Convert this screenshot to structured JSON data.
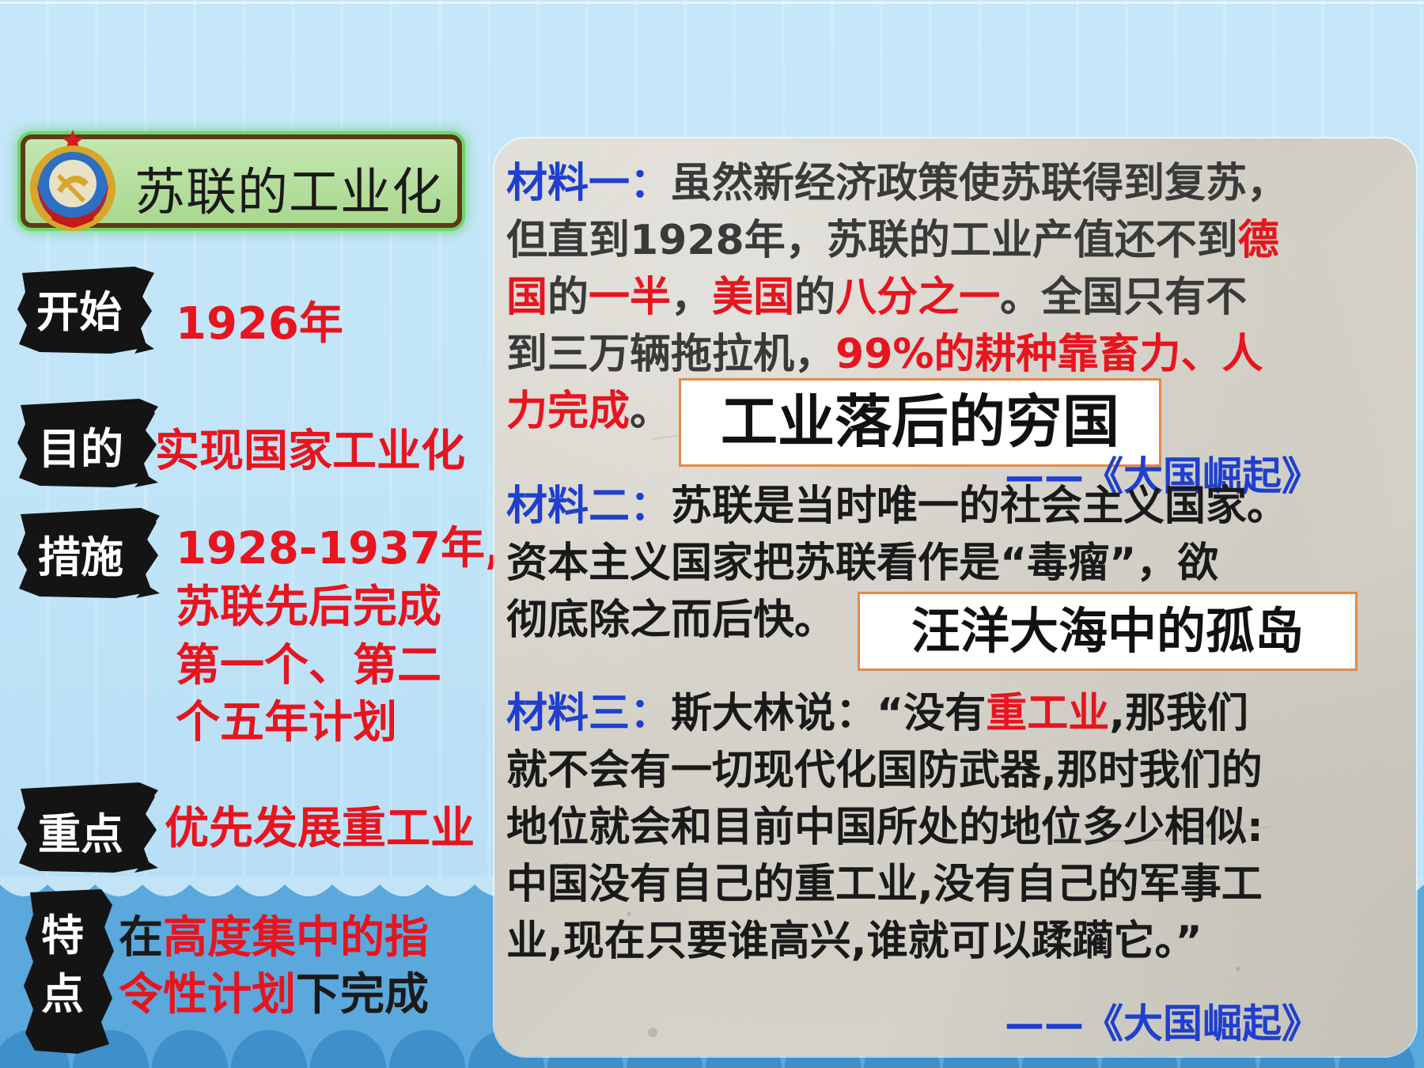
{
  "title": "苏联的工业化",
  "items": [
    {
      "label": "开始",
      "value": "1926年"
    },
    {
      "label": "目的",
      "value": "实现国家工业化"
    },
    {
      "label": "措施",
      "value_lines": [
        "1928-1937年,",
        "苏联先后完成",
        "第一个、第二",
        "个五年计划"
      ]
    },
    {
      "label": "重点",
      "value": "优先发展重工业"
    },
    {
      "label_lines": [
        "特",
        "点"
      ],
      "value_parts": [
        {
          "text": "在",
          "color": "black"
        },
        {
          "text": "高度集中的指",
          "color": "red"
        },
        {
          "text": "令性计划",
          "color": "red"
        },
        {
          "text": "下完成",
          "color": "black"
        }
      ]
    }
  ],
  "materials": {
    "m1": {
      "head": "材料一：",
      "l1": "虽然新经济政策使苏联得到复苏，",
      "l2a": "但直到1928年，苏联的工业产值还不到",
      "l2b": "德",
      "l3a": "国",
      "l3b": "的",
      "l3c": "一半",
      "l3d": "，",
      "l3e": "美国",
      "l3f": "的",
      "l3g": "八分之一",
      "l3h": "。全国只有不",
      "l4a": "到三万辆拖拉机，",
      "l4b": "99%的耕种靠畜力、人",
      "l5a": "力完成",
      "l5b": "。",
      "box": "工业落后的穷国",
      "source": "——《大国崛起》"
    },
    "m2": {
      "head": "材料二：",
      "l1": "苏联是当时唯一的社会主义国家。",
      "l2": "资本主义国家把苏联看作是“毒瘤”，欲",
      "l3": "彻底除之而后快。",
      "box": "汪洋大海中的孤岛"
    },
    "m3": {
      "head": "材料三：",
      "l1a": "斯大林说：“没有",
      "l1b": "重工业",
      "l1c": ",那我们",
      "l2": "就不会有一切现代化国防武器,那时我们的",
      "l3": "地位就会和目前中国所处的地位多少相似:",
      "l4": "中国没有自己的重工业,没有自己的军事工",
      "l5": "业,现在只要谁高兴,谁就可以蹂躏它。”",
      "source": "——《大国崛起》"
    }
  },
  "colors": {
    "red": "#e8141e",
    "blue": "#1e3fd0",
    "background": "#c6e7f9",
    "wave": "#5aa8dc"
  }
}
